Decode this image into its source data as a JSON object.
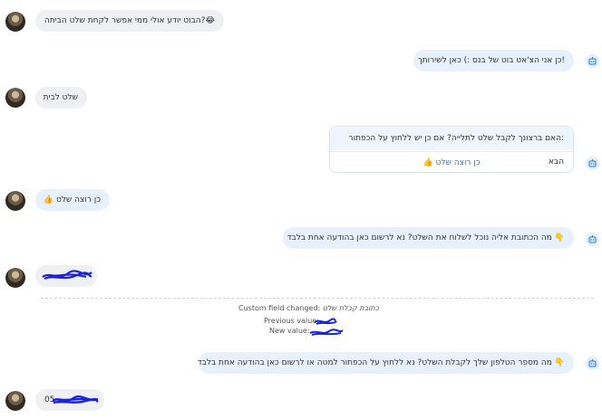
{
  "messages": {
    "m1": "?הבוט יודע אולי ממי אפשר לקחת שלט הביתה",
    "m1_emoji": "😂",
    "m2": "!כן אני הצ'אט בוט של בנס :) כאן לשירותך",
    "m3": "שלט לבית",
    "m4": ":האם ברצונך לקבל שלט לתלייה? אם כן יש ללחוץ על הכפתור הבא",
    "m4_button": "כן רוצה שלט",
    "m4_button_emoji": "👍",
    "m5": "כן רוצה שלט",
    "m5_emoji": "👍",
    "m6": "מה הכתובת אליה נוכל לשלוח את השלט? נא לרשום כאן בהודעה אחת בלבד",
    "m6_emoji": "👇",
    "m8": "מה מספר הטלפון שלך לקבלת השלט? נא ללחוץ על הכפתור למטה או לרשום כאן בהודעה אחת בלבד",
    "m8_emoji": "👇",
    "m9_prefix": "05"
  },
  "system": {
    "label": "Custom field changed:",
    "field": "כתובת קבלת שלט",
    "previous": "Previous value:",
    "new": "New value:"
  },
  "colors": {
    "user_bubble": "#eef0f3",
    "bot_bubble": "#e7f1fd",
    "button_text": "#2a77d8",
    "scribble": "#1a22e0"
  }
}
